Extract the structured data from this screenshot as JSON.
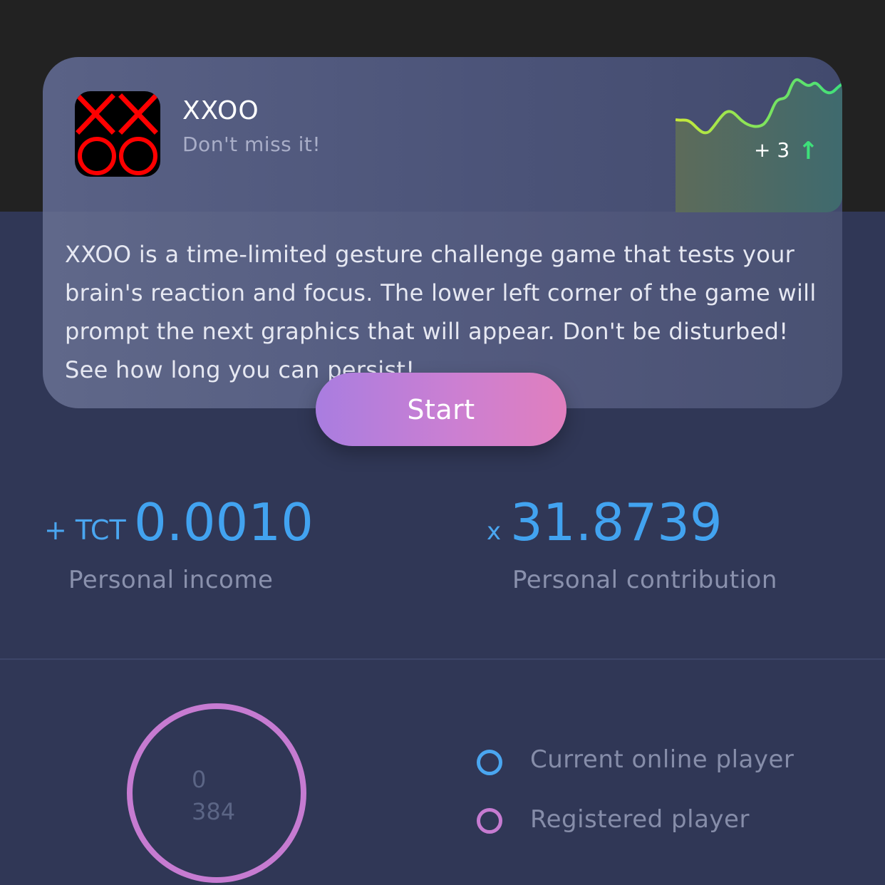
{
  "game": {
    "title": "XXOO",
    "subtitle": "Don't miss it!",
    "trend_value": "+ 3",
    "trend_icon": "arrow-up-icon",
    "description": "XXOO is a time-limited gesture challenge game that tests your brain's reaction and focus. The lower left corner of the game will prompt the next graphics that will appear. Don't be disturbed! See how long you can persist!",
    "start_label": "Start"
  },
  "stats": {
    "income_prefix": "+ TCT",
    "income_value": "0.0010",
    "income_label": "Personal income",
    "contribution_prefix": "x",
    "contribution_value": "31.8739",
    "contribution_label": "Personal contribution"
  },
  "players": {
    "online_count": "0",
    "registered_count": "384",
    "legend": [
      {
        "label": "Current online player",
        "color": "#4aa6f0"
      },
      {
        "label": "Registered player",
        "color": "#c67bd1"
      }
    ]
  },
  "colors": {
    "accent_blue": "#42a3f0",
    "accent_purple": "#c67bd1",
    "trend_green": "#3de07a",
    "background": "#303756"
  }
}
